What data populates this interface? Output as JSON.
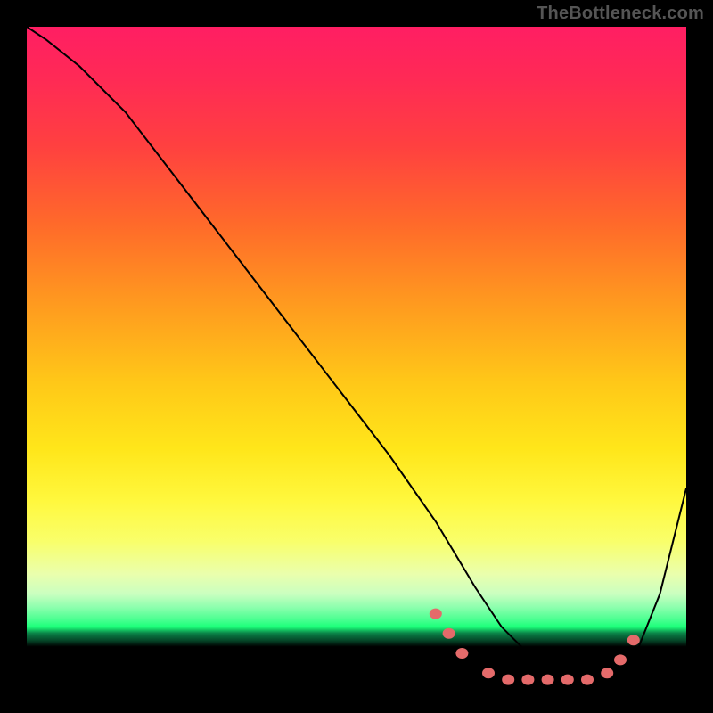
{
  "watermark": "TheBottleneck.com",
  "chart_data": {
    "type": "line",
    "title": "",
    "xlabel": "",
    "ylabel": "",
    "xlim": [
      0,
      100
    ],
    "ylim": [
      0,
      100
    ],
    "legend": false,
    "grid": false,
    "background_gradient_stops": [
      {
        "pos": 0,
        "color": "#ff1e63"
      },
      {
        "pos": 18,
        "color": "#ff4040"
      },
      {
        "pos": 42,
        "color": "#ff9a1f"
      },
      {
        "pos": 64,
        "color": "#ffe61a"
      },
      {
        "pos": 83,
        "color": "#eaffad"
      },
      {
        "pos": 90,
        "color": "#46ff8f"
      },
      {
        "pos": 93,
        "color": "#054a2a"
      },
      {
        "pos": 100,
        "color": "#000000"
      }
    ],
    "series": [
      {
        "name": "bottleneck-curve",
        "color": "#000000",
        "x": [
          0,
          3,
          8,
          15,
          25,
          35,
          45,
          55,
          62,
          68,
          72,
          76,
          80,
          84,
          88,
          92,
          96,
          100
        ],
        "y": [
          100,
          98,
          94,
          87,
          74,
          61,
          48,
          35,
          25,
          15,
          9,
          5,
          2,
          1,
          1,
          4,
          14,
          30
        ]
      }
    ],
    "markers": {
      "name": "highlight-points",
      "color": "#e46a6a",
      "points": [
        {
          "x": 62,
          "y": 11
        },
        {
          "x": 64,
          "y": 8
        },
        {
          "x": 66,
          "y": 5
        },
        {
          "x": 70,
          "y": 2
        },
        {
          "x": 73,
          "y": 1
        },
        {
          "x": 76,
          "y": 1
        },
        {
          "x": 79,
          "y": 1
        },
        {
          "x": 82,
          "y": 1
        },
        {
          "x": 85,
          "y": 1
        },
        {
          "x": 88,
          "y": 2
        },
        {
          "x": 90,
          "y": 4
        },
        {
          "x": 92,
          "y": 7
        }
      ]
    }
  }
}
